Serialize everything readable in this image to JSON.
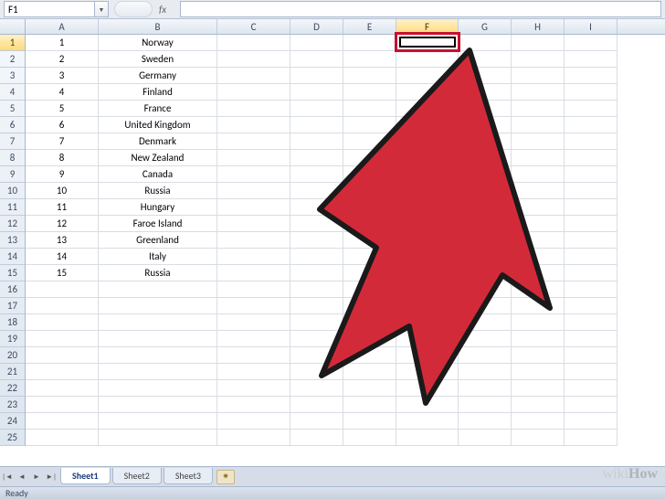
{
  "nameBox": {
    "value": "F1"
  },
  "formulaBar": {
    "value": ""
  },
  "columns": [
    "A",
    "B",
    "C",
    "D",
    "E",
    "F",
    "G",
    "H",
    "I"
  ],
  "activeCol": "F",
  "activeRowIndex": 1,
  "totalRows": 25,
  "rows": [
    {
      "a": "1",
      "b": "Norway"
    },
    {
      "a": "2",
      "b": "Sweden"
    },
    {
      "a": "3",
      "b": "Germany"
    },
    {
      "a": "4",
      "b": "Finland"
    },
    {
      "a": "5",
      "b": "France"
    },
    {
      "a": "6",
      "b": "United Kingdom"
    },
    {
      "a": "7",
      "b": "Denmark"
    },
    {
      "a": "8",
      "b": "New Zealand"
    },
    {
      "a": "9",
      "b": "Canada"
    },
    {
      "a": "10",
      "b": "Russia"
    },
    {
      "a": "11",
      "b": "Hungary"
    },
    {
      "a": "12",
      "b": "Faroe Island"
    },
    {
      "a": "13",
      "b": "Greenland"
    },
    {
      "a": "14",
      "b": "Italy"
    },
    {
      "a": "15",
      "b": "Russia"
    }
  ],
  "sheets": {
    "active": "Sheet1",
    "items": [
      "Sheet1",
      "Sheet2",
      "Sheet3"
    ]
  },
  "statusBar": {
    "text": "Ready"
  },
  "watermark": {
    "prefix": "wiki",
    "suffix": "How"
  }
}
